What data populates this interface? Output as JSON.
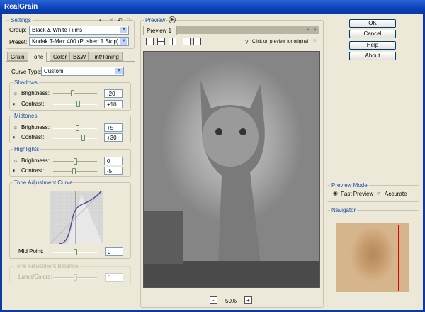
{
  "window": {
    "title": "RealGrain"
  },
  "settings": {
    "legend": "Settings",
    "group_label": "Group:",
    "group_value": "Black & White Films",
    "preset_label": "Preset:",
    "preset_value": "Kodak T-Max 400 (Pushed 1 Stop)"
  },
  "tabs": [
    "Grain",
    "Tone",
    "Color",
    "B&W",
    "Tint/Toning"
  ],
  "tone": {
    "curve_type_label": "Curve Type:",
    "curve_type_value": "Custom",
    "shadows": {
      "legend": "Shadows",
      "brightness_label": "Brightness:",
      "brightness": "-20",
      "contrast_label": "Contrast:",
      "contrast": "+10"
    },
    "midtones": {
      "legend": "Midtones",
      "brightness_label": "Brightness:",
      "brightness": "+5",
      "contrast_label": "Contrast:",
      "contrast": "+30"
    },
    "highlights": {
      "legend": "Highlights",
      "brightness_label": "Brightness:",
      "brightness": "0",
      "contrast_label": "Contrast:",
      "contrast": "-5"
    },
    "curve": {
      "legend": "Tone Adjustment Curve",
      "mid_point_label": "Mid Point:",
      "mid_point": "0"
    },
    "balance": {
      "legend": "Tone Adjustment Balance",
      "luma_label": "Luma/Colors:",
      "luma": "0"
    }
  },
  "preview": {
    "legend": "Preview",
    "tab": "Preview 1",
    "hint": "Click on preview for original",
    "help": "?",
    "zoom": "50%",
    "zoom_out": "-",
    "zoom_in": "+"
  },
  "buttons": {
    "ok": "OK",
    "cancel": "Cancel",
    "help": "Help",
    "about": "About"
  },
  "preview_mode": {
    "legend": "Preview Mode",
    "fast": "Fast Preview",
    "accurate": "Accurate",
    "selected": "fast"
  },
  "navigator": {
    "legend": "Navigator"
  }
}
